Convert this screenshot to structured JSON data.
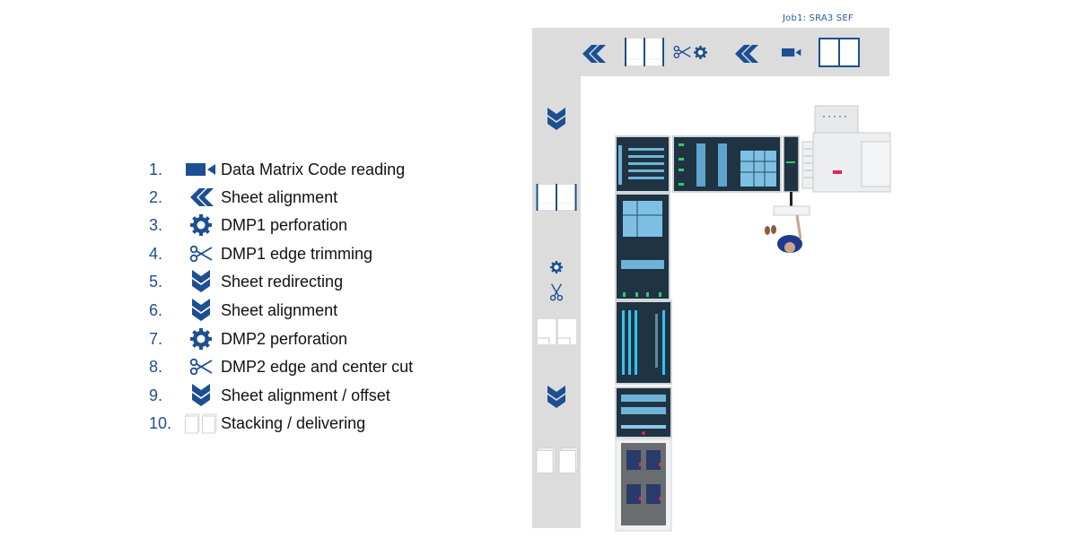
{
  "diagram": {
    "job_label": "Job1: SRA3 SEF",
    "accent_color": "#1d4f91",
    "lane_color": "#dcdcdc",
    "legend": [
      {
        "number": "1.",
        "icon": "camera-icon",
        "label": "Data Matrix Code reading"
      },
      {
        "number": "2.",
        "icon": "double-chevron-left-icon",
        "label": "Sheet alignment"
      },
      {
        "number": "3.",
        "icon": "gear-icon",
        "label": "DMP1 perforation"
      },
      {
        "number": "4.",
        "icon": "scissors-icon",
        "label": "DMP1 edge trimming"
      },
      {
        "number": "5.",
        "icon": "double-chevron-down-icon",
        "label": "Sheet redirecting"
      },
      {
        "number": "6.",
        "icon": "double-chevron-down-icon",
        "label": "Sheet alignment"
      },
      {
        "number": "7.",
        "icon": "gear-icon",
        "label": "DMP2 perforation"
      },
      {
        "number": "8.",
        "icon": "scissors-icon",
        "label": "DMP2 edge and center cut"
      },
      {
        "number": "9.",
        "icon": "double-chevron-down-icon",
        "label": "Sheet alignment / offset"
      },
      {
        "number": "10.",
        "icon": "stacked-sheets-icon",
        "label": "Stacking / delivering"
      }
    ],
    "top_lane_icons": [
      "double-chevron-left-icon",
      "trimmed-sheet-icon",
      "scissors-icon",
      "gear-icon",
      "double-chevron-left-icon",
      "camera-icon",
      "sheet-icon"
    ],
    "side_lane_icons": [
      "double-chevron-down-icon",
      "trimmed-sheet-icon",
      "gear-icon",
      "scissors-icon",
      "cut-sheets-icon",
      "double-chevron-down-icon",
      "stacked-sheets-icon"
    ]
  }
}
